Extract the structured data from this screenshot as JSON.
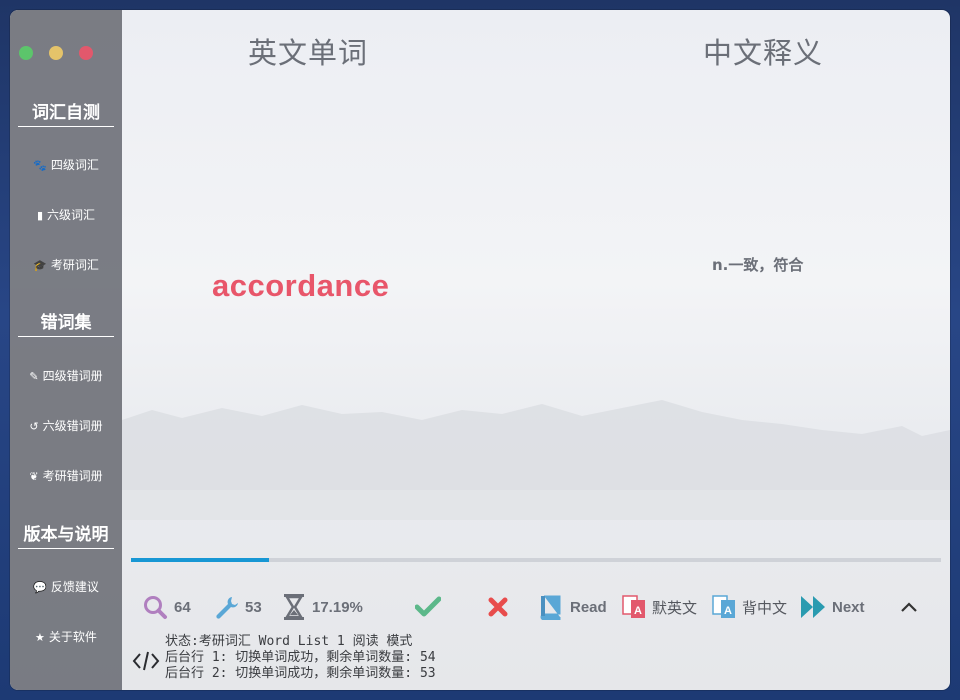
{
  "window": {
    "lights": [
      "#5cc56b",
      "#e4c36a",
      "#e2586c"
    ]
  },
  "sidebar": {
    "sections": [
      {
        "title": "词汇自测",
        "items": [
          {
            "icon": "paw-icon",
            "label": "四级词汇"
          },
          {
            "icon": "book-icon",
            "label": "六级词汇"
          },
          {
            "icon": "graduation-cap-icon",
            "label": "考研词汇"
          }
        ]
      },
      {
        "title": "错词集",
        "items": [
          {
            "icon": "edit-icon",
            "label": "四级错词册"
          },
          {
            "icon": "history-icon",
            "label": "六级错词册"
          },
          {
            "icon": "leaf-icon",
            "label": "考研错词册"
          }
        ]
      },
      {
        "title": "版本与说明",
        "items": [
          {
            "icon": "comment-icon",
            "label": "反馈建议"
          },
          {
            "icon": "star-icon",
            "label": "关于软件"
          }
        ]
      }
    ]
  },
  "main": {
    "headers": {
      "english": "英文单词",
      "chinese": "中文释义"
    },
    "word": "accordance",
    "meaning": "n.一致，符合",
    "progress": 0.17
  },
  "toolbar": {
    "search_count": "64",
    "wrench_count": "53",
    "percent": "17.19%",
    "read_label": "Read",
    "dictate_en_label": "默英文",
    "recite_cn_label": "背中文",
    "next_label": "Next"
  },
  "log": {
    "lines": [
      "状态:考研词汇 Word List 1 阅读 模式",
      "后台行 1: 切换单词成功，剩余单词数量: 54",
      "后台行 2: 切换单词成功，剩余单词数量: 53"
    ]
  },
  "colors": {
    "accent_red": "#e8566a",
    "progress_blue": "#1797d4",
    "check_green": "#5cb88a",
    "cross_red": "#e84c4c",
    "teal": "#2a9bb0"
  }
}
